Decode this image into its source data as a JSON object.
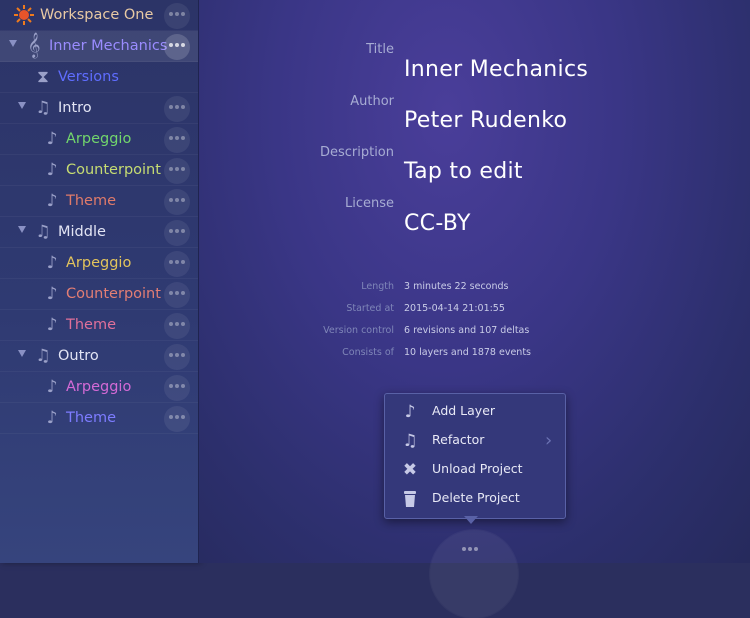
{
  "sidebar": {
    "workspace": {
      "label": "Workspace One",
      "icon": "sun-icon",
      "color": "#e8c9a4"
    },
    "items": [
      {
        "label": "Inner Mechanics",
        "icon": "treble-clef-icon",
        "color": "#9a8cff",
        "expanded": true
      },
      {
        "label": "Versions",
        "icon": "hourglass-icon",
        "color": "#5f6dff"
      },
      {
        "label": "Intro",
        "icon": "music-notes-icon",
        "color": "#e2e4f4",
        "expanded": true
      },
      {
        "label": "Arpeggio",
        "icon": "music-note-icon",
        "color": "#72d66c"
      },
      {
        "label": "Counterpoint",
        "icon": "music-note-icon",
        "color": "#c6dc72"
      },
      {
        "label": "Theme",
        "icon": "music-note-icon",
        "color": "#e07b6a"
      },
      {
        "label": "Middle",
        "icon": "music-notes-icon",
        "color": "#e2e4f4",
        "expanded": true
      },
      {
        "label": "Arpeggio",
        "icon": "music-note-icon",
        "color": "#e3c45c"
      },
      {
        "label": "Counterpoint",
        "icon": "music-note-icon",
        "color": "#e37e74"
      },
      {
        "label": "Theme",
        "icon": "music-note-icon",
        "color": "#e0709a"
      },
      {
        "label": "Outro",
        "icon": "music-notes-icon",
        "color": "#e2e4f4",
        "expanded": true
      },
      {
        "label": "Arpeggio",
        "icon": "music-note-icon",
        "color": "#d46ad6"
      },
      {
        "label": "Theme",
        "icon": "music-note-icon",
        "color": "#7d7cff"
      }
    ]
  },
  "details": {
    "title_label": "Title",
    "title_value": "Inner Mechanics",
    "author_label": "Author",
    "author_value": "Peter Rudenko",
    "description_label": "Description",
    "description_value": "Tap to edit",
    "license_label": "License",
    "license_value": "CC-BY"
  },
  "stats": {
    "length_label": "Length",
    "length_value": "3 minutes 22 seconds",
    "started_label": "Started at",
    "started_value": "2015-04-14 21:01:55",
    "vc_label": "Version control",
    "vc_value": "6 revisions and 107 deltas",
    "consists_label": "Consists of",
    "consists_value": "10 layers and 1878 events"
  },
  "menu": {
    "items": [
      {
        "label": "Add Layer",
        "icon": "music-note-icon"
      },
      {
        "label": "Refactor",
        "icon": "music-notes-icon",
        "has_submenu": true
      },
      {
        "label": "Unload Project",
        "icon": "x-icon"
      },
      {
        "label": "Delete Project",
        "icon": "trash-icon"
      }
    ]
  },
  "colors": {
    "accent": "#5961a6",
    "background": "#3a3686"
  }
}
